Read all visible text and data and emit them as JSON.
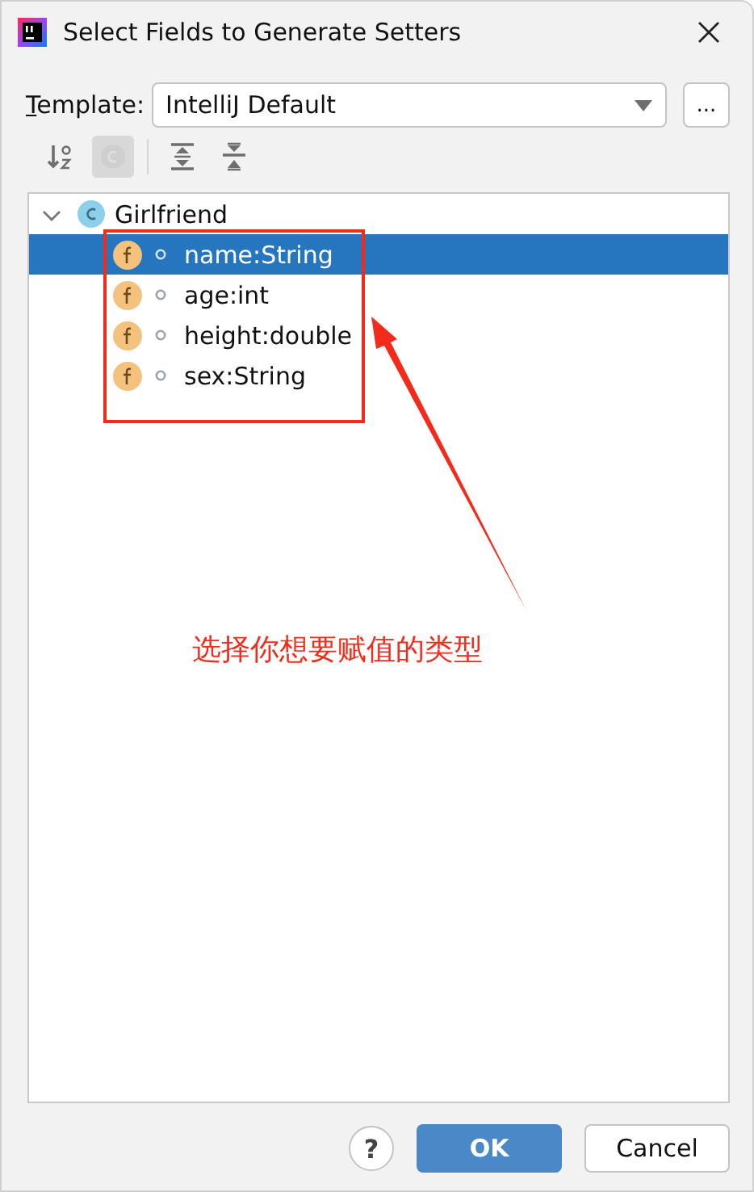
{
  "window": {
    "title": "Select Fields to Generate Setters"
  },
  "template": {
    "label": "Template:",
    "value": "IntelliJ Default",
    "more_button": "..."
  },
  "tree": {
    "label": "Girlfriend",
    "expanded": true,
    "children": [
      {
        "label": "name:String",
        "selected": true
      },
      {
        "label": "age:int",
        "selected": false
      },
      {
        "label": "height:double",
        "selected": false
      },
      {
        "label": "sex:String",
        "selected": false
      }
    ]
  },
  "annotation": {
    "note": "选择你想要赋值的类型"
  },
  "buttons": {
    "help": "?",
    "ok": "OK",
    "cancel": "Cancel"
  }
}
